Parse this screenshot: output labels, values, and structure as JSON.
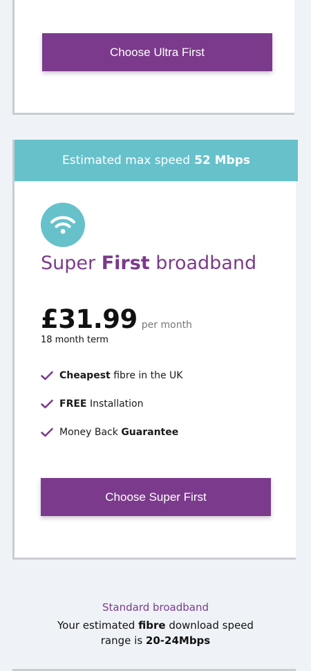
{
  "ultra_card": {
    "button_label": "Choose Ultra First"
  },
  "super_card": {
    "speed_prefix": "Estimated max speed",
    "speed_value": "52 Mbps",
    "title_part1": "Super",
    "title_part2": "First",
    "title_part3": "broadband",
    "price": "£31.99",
    "price_period": "per month",
    "term": "18 month term",
    "features": [
      {
        "bold": "Cheapest",
        "rest": "fibre in the UK"
      },
      {
        "bold": "FREE",
        "rest": "Installation"
      },
      {
        "pre": "Money Back",
        "bold": "Guarantee"
      }
    ],
    "button_label": "Choose Super First"
  },
  "standard": {
    "label": "Standard broadband",
    "desc_part1": "Your estimated",
    "desc_bold1": "fibre",
    "desc_part2": "download speed range is",
    "desc_bold2": "20-24Mbps"
  },
  "colors": {
    "brand_purple": "#7b3a8c",
    "accent_teal": "#66c1cb",
    "background": "#eff3f7"
  },
  "icons": {
    "wifi": "wifi-icon",
    "check": "check-icon"
  }
}
